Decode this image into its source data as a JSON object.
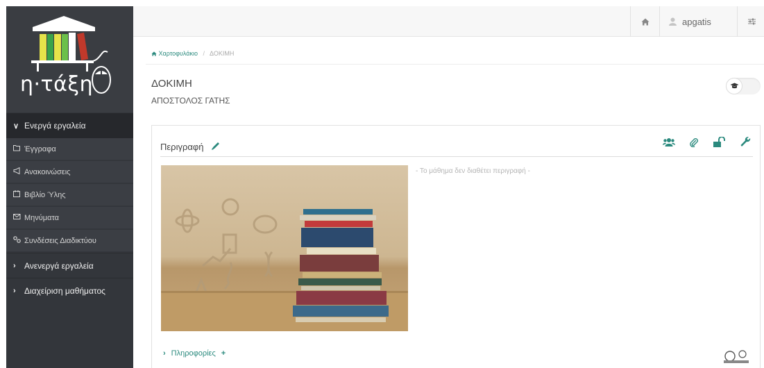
{
  "sidebar": {
    "brand": "η·τάξη",
    "active_section": "Ενεργά εργαλεία",
    "items": [
      {
        "icon": "folder-open-icon",
        "label": "Έγγραφα"
      },
      {
        "icon": "bullhorn-icon",
        "label": "Ανακοινώσεις"
      },
      {
        "icon": "calendar-icon",
        "label": "Βιβλίο Ύλης"
      },
      {
        "icon": "envelope-icon",
        "label": "Μηνύματα"
      },
      {
        "icon": "link-icon",
        "label": "Συνδέσεις Διαδικτύου"
      }
    ],
    "inactive_section": "Ανενεργά εργαλεία",
    "admin_section": "Διαχείριση μαθήματος"
  },
  "topbar": {
    "username": "apgatis"
  },
  "breadcrumb": {
    "home": "Χαρτοφυλάκιο",
    "current": "ΔΟΚΙΜΗ"
  },
  "course": {
    "title": "ΔΟΚΙΜΗ",
    "instructor": "ΑΠΟΣΤΟΛΟΣ ΓΑΤΗΣ"
  },
  "panel": {
    "title": "Περιγραφή",
    "no_description": "- Το μάθημα δεν διαθέτει περιγραφή -",
    "info_link": "Πληροφορίες"
  },
  "colors": {
    "accent": "#2b8a7e",
    "sidebar_bg": "#33363b"
  }
}
